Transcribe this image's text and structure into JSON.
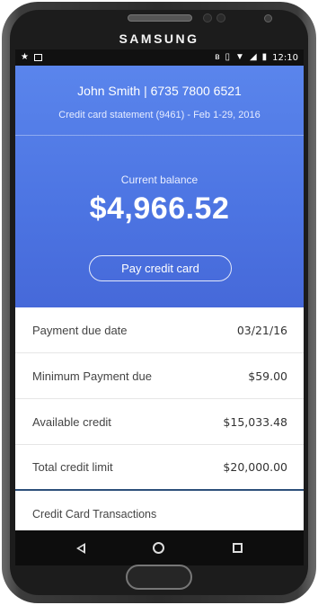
{
  "device": {
    "brand": "SAMSUNG"
  },
  "status_bar": {
    "time": "12:10",
    "left_icons": [
      "star-icon",
      "image-icon"
    ],
    "right_icons": [
      "bluetooth-icon",
      "vibrate-icon",
      "wifi-icon",
      "signal-icon",
      "battery-icon"
    ]
  },
  "header": {
    "account_line": "John Smith  |  6735 7800 6521",
    "statement_line": "Credit card statement (9461) - Feb 1-29, 2016",
    "balance_label": "Current balance",
    "balance_amount": "$4,966.52",
    "pay_button_label": "Pay credit card"
  },
  "details": [
    {
      "label": "Payment due date",
      "value": "03/21/16"
    },
    {
      "label": "Minimum Payment due",
      "value": "$59.00"
    },
    {
      "label": "Available credit",
      "value": "$15,033.48"
    },
    {
      "label": "Total credit limit",
      "value": "$20,000.00"
    }
  ],
  "transactions_title": "Credit Card Transactions",
  "nav": [
    "back-icon",
    "home-icon",
    "recent-apps-icon"
  ],
  "colors": {
    "header_top": "#5a85ec",
    "header_bottom": "#4669d9",
    "section_accent": "#2d4f7a"
  }
}
